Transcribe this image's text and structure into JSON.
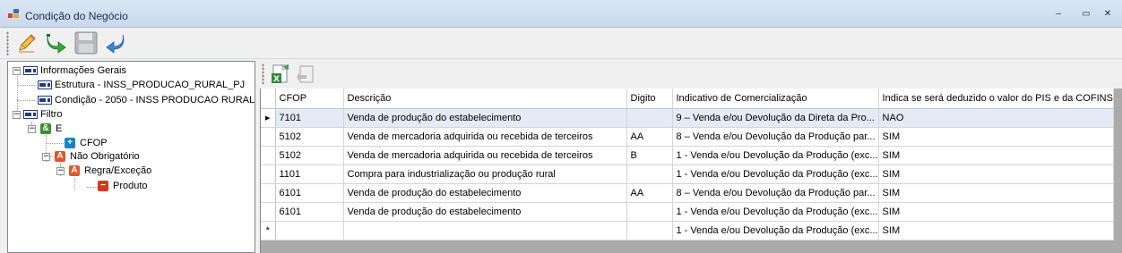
{
  "window": {
    "title": "Condição do Negócio",
    "minimize_glyph": "‒",
    "maximize_glyph": "▭",
    "close_glyph": "✕"
  },
  "toolbar": {
    "icons": [
      "edit-pencil-icon",
      "go-forward-icon",
      "save-disk-icon",
      "undo-arrow-icon"
    ]
  },
  "tree": {
    "info_root": "Informações Gerais",
    "info_children": [
      "Estrutura - INSS_PRODUCAO_RURAL_PJ",
      "Condição - 2050 - INSS PRODUCAO RURAL"
    ],
    "filter_root": "Filtro",
    "e_node": "E",
    "cfop_node": "CFOP",
    "nao_obrigatorio": "Não Obrigatório",
    "regra_excecao": "Regra/Exceção",
    "produto": "Produto",
    "expand_glyph": "−"
  },
  "grid": {
    "columns": [
      "CFOP",
      "Descrição",
      "Digito",
      "Indicativo de Comercialização",
      "Indica se será deduzido o valor do PIS e da COFINS"
    ],
    "rows": [
      {
        "marker": "▶",
        "cfop": "7101",
        "descricao": "Venda de produção do estabelecimento",
        "digito": "",
        "indicativo": "9 – Venda e/ou Devolução da Direta da Pro...",
        "pis_cofins": "NAO"
      },
      {
        "marker": "",
        "cfop": "5102",
        "descricao": "Venda de mercadoria adquirida ou recebida de terceiros",
        "digito": "AA",
        "indicativo": "8 – Venda e/ou Devolução da Produção par...",
        "pis_cofins": "SIM"
      },
      {
        "marker": "",
        "cfop": "5102",
        "descricao": "Venda de mercadoria adquirida ou recebida de terceiros",
        "digito": "B",
        "indicativo": "1 - Venda e/ou Devolução da Produção (exc...",
        "pis_cofins": "SIM"
      },
      {
        "marker": "",
        "cfop": "1101",
        "descricao": "Compra para industrialização ou produção rural",
        "digito": "",
        "indicativo": "1 - Venda e/ou Devolução da Produção (exc...",
        "pis_cofins": "SIM"
      },
      {
        "marker": "",
        "cfop": "6101",
        "descricao": "Venda de produção do estabelecimento",
        "digito": "AA",
        "indicativo": "8 – Venda e/ou Devolução da Produção par...",
        "pis_cofins": "SIM"
      },
      {
        "marker": "",
        "cfop": "6101",
        "descricao": "Venda de produção do estabelecimento",
        "digito": "",
        "indicativo": "1 - Venda e/ou Devolução da Produção (exc...",
        "pis_cofins": "SIM"
      },
      {
        "marker": "*",
        "cfop": "",
        "descricao": "",
        "digito": "",
        "indicativo": "1 - Venda e/ou Devolução da Produção (exc...",
        "pis_cofins": "SIM"
      }
    ]
  },
  "colors": {
    "selected_row": "#e3ebf6",
    "and_node": "#3a8f2e",
    "cfop_node": "#1f7fc7",
    "not_required_node": "#e0572a",
    "produto_node": "#d23a1e"
  }
}
